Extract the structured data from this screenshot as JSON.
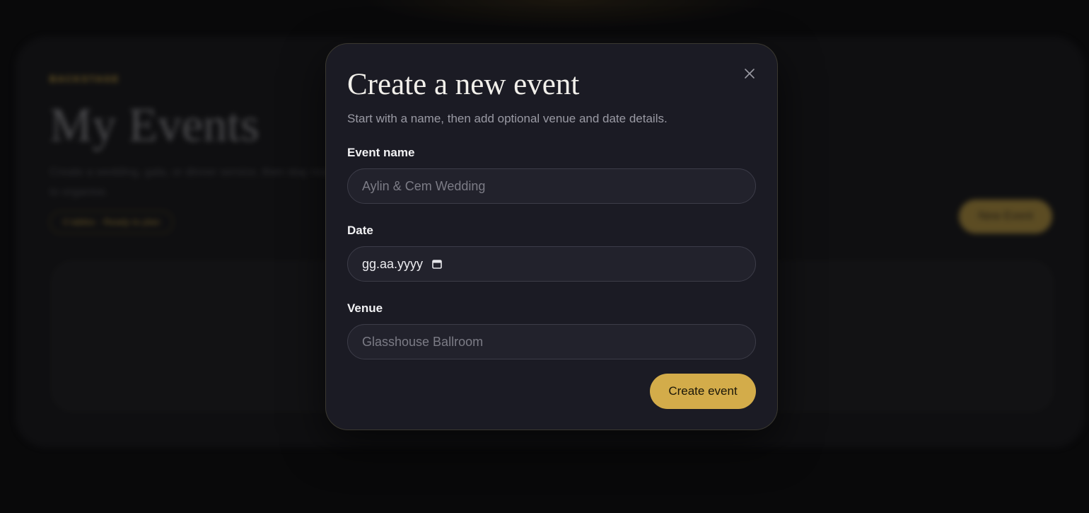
{
  "background": {
    "eyebrow": "Backstage",
    "title": "My Events",
    "subtitle": "Create a wedding, gala, or dinner service, then stay ready to organise.",
    "chip": "0 tables · Ready to plan",
    "new_event_label": "New Event"
  },
  "modal": {
    "title": "Create a new event",
    "description": "Start with a name, then add optional venue and date details.",
    "close_icon": "close-icon",
    "fields": {
      "event_name": {
        "label": "Event name",
        "placeholder": "Aylin & Cem Wedding",
        "value": ""
      },
      "date": {
        "label": "Date",
        "display_value": "gg.aa.yyyy",
        "icon": "calendar-icon"
      },
      "venue": {
        "label": "Venue",
        "placeholder": "Glasshouse Ballroom",
        "value": ""
      }
    },
    "submit_label": "Create event"
  },
  "colors": {
    "accent": "#d3ac4a",
    "modal_bg": "#1b1b24",
    "page_bg": "#0b0b0d"
  }
}
